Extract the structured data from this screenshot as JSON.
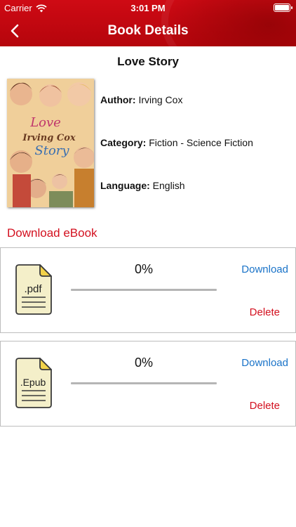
{
  "status_bar": {
    "carrier": "Carrier",
    "time": "3:01 PM"
  },
  "nav": {
    "title": "Book Details"
  },
  "book": {
    "title": "Love Story",
    "cover": {
      "line1": "Love",
      "line2": "Irving Cox",
      "line3": "Story"
    },
    "author_label": "Author:",
    "author": "Irving Cox",
    "category_label": "Category:",
    "category": "Fiction - Science Fiction",
    "language_label": "Language:",
    "language": "English"
  },
  "downloads": {
    "title": "Download eBook",
    "items": [
      {
        "format": ".pdf",
        "percent": "0%",
        "progress": 0,
        "download_label": "Download",
        "delete_label": "Delete"
      },
      {
        "format": ".Epub",
        "percent": "0%",
        "progress": 0,
        "download_label": "Download",
        "delete_label": "Delete"
      }
    ]
  },
  "colors": {
    "header": "#c80a13",
    "accent_red": "#d3101f",
    "link_blue": "#1a73c8"
  }
}
